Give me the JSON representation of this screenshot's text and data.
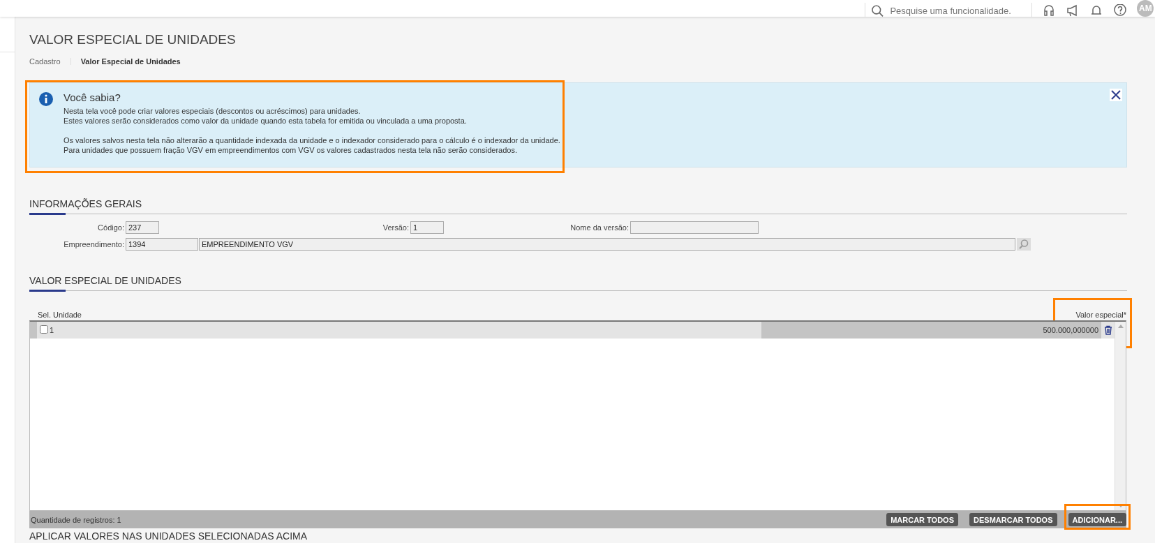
{
  "topbar": {
    "search": {
      "placeholder": "Pesquise uma funcionalidade."
    },
    "avatar": "AM"
  },
  "page": {
    "title": "VALOR ESPECIAL DE UNIDADES",
    "breadcrumb": [
      {
        "label": "Cadastro",
        "current": false
      },
      {
        "label": "Valor Especial de Unidades",
        "current": true
      }
    ]
  },
  "info": {
    "title": "Você sabia?",
    "highlighted": true,
    "paragraphs": [
      [
        "Nesta tela você pode criar valores especiais (descontos ou acréscimos) para unidades.",
        "Estes valores serão considerados como valor da unidade quando esta tabela for emitida ou vinculada a uma proposta."
      ],
      [
        "Os valores salvos nesta tela não alterarão a quantidade indexada da unidade e o indexador considerado para o cálculo é o indexador da unidade.",
        "Para unidades que possuem fração VGV em empreendimentos com VGV os valores cadastrados nesta tela não serão considerados."
      ]
    ]
  },
  "general": {
    "heading": "INFORMAÇÕES GERAIS",
    "codigo": {
      "label": "Código:",
      "value": "237"
    },
    "versao": {
      "label": "Versão:",
      "value": "1"
    },
    "nome_versao": {
      "label": "Nome da versão:"
    },
    "empreendimento": {
      "label": "Empreendimento:",
      "code": "1394",
      "name": "EMPREENDIMENTO VGV"
    }
  },
  "units": {
    "heading": "VALOR ESPECIAL DE UNIDADES",
    "columns": [
      {
        "label": "Sel. Unidade",
        "highlighted": false
      },
      {
        "label": "Valor especial*",
        "highlighted": true
      }
    ],
    "rows": [
      {
        "checked": false,
        "unit": "1",
        "value": "500.000,000000"
      }
    ],
    "count": "Quantidade de registros: 1",
    "buttons": [
      {
        "label": "MARCAR TODOS",
        "highlighted": false
      },
      {
        "label": "DESMARCAR TODOS",
        "highlighted": false
      },
      {
        "label": "ADICIONAR...",
        "highlighted": true
      }
    ]
  },
  "next_heading": "APLICAR VALORES NAS UNIDADES SELECIONADAS ACIMA"
}
